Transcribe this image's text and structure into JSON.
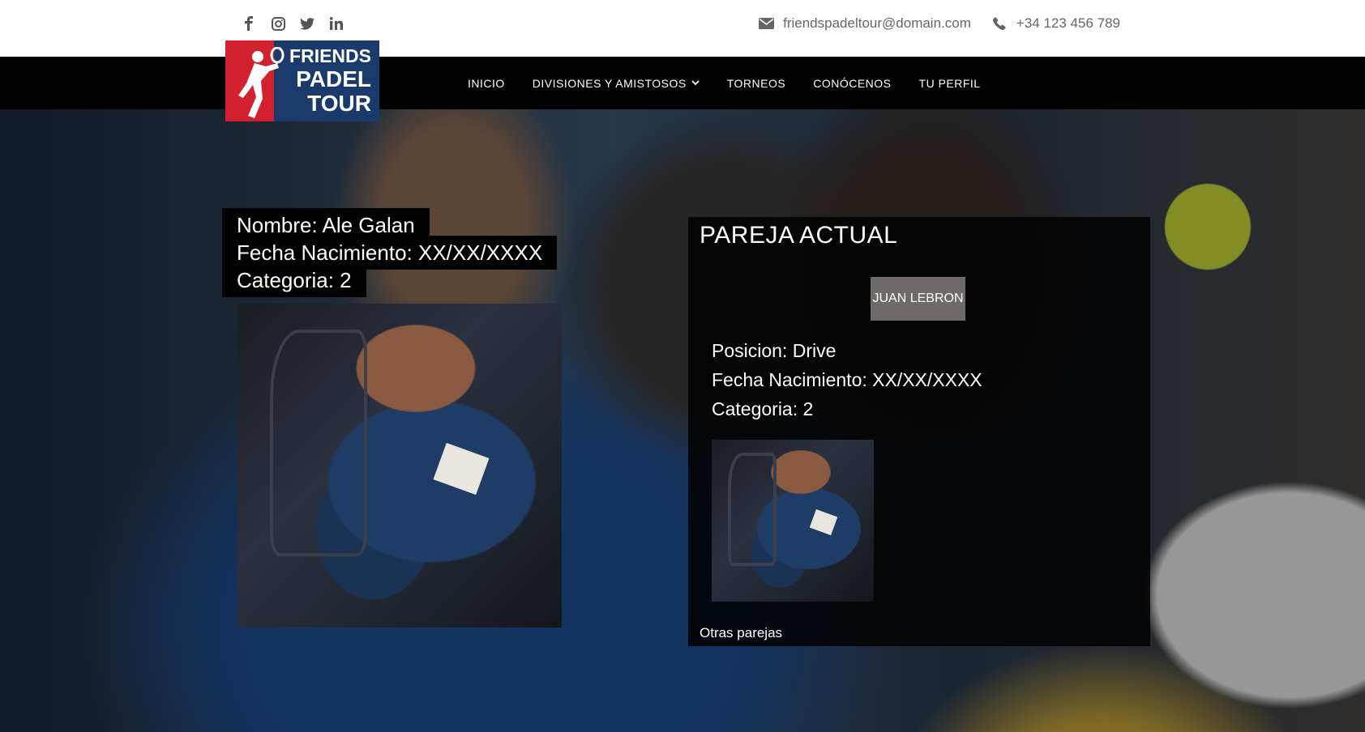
{
  "social": {
    "items": [
      {
        "icon": "facebook-icon",
        "glyph": "f"
      },
      {
        "icon": "instagram-icon",
        "glyph": "◎"
      },
      {
        "icon": "twitter-icon",
        "glyph": "🐦"
      },
      {
        "icon": "linkedin-icon",
        "glyph": "in"
      }
    ]
  },
  "contact": {
    "email": "friendspadeltour@domain.com",
    "phone": "+34 123 456 789"
  },
  "logo": {
    "line1": "FRIENDS",
    "line2": "PADEL",
    "line3": "TOUR"
  },
  "nav": {
    "items": [
      "INICIO",
      "DIVISIONES Y AMISTOSOS",
      "TORNEOS",
      "CONÓCENOS",
      "TU PERFIL"
    ]
  },
  "player": {
    "nombre": "Nombre: Ale Galan",
    "fecha": "Fecha Nacimiento: XX/XX/XXXX",
    "categoria": "Categoria: 2"
  },
  "pareja": {
    "title": "PAREJA ACTUAL",
    "partner_button": "JUAN LEBRON",
    "posicion": "Posicion: Drive",
    "fecha": "Fecha Nacimiento: XX/XX/XXXX",
    "categoria": "Categoria: 2",
    "otras": "Otras parejas"
  },
  "colors": {
    "logo_blue": "#1a3a6b",
    "logo_red": "#d2202e",
    "nav_bg": "#000000",
    "button_grey": "#6f6a68"
  }
}
